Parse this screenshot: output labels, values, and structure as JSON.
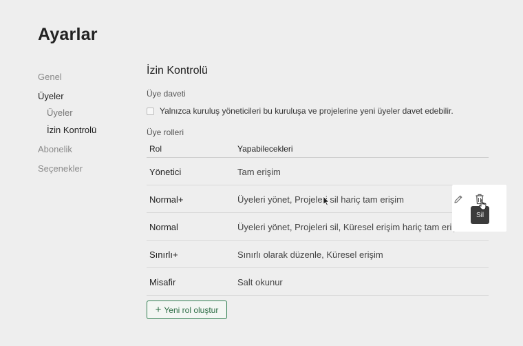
{
  "page": {
    "title": "Ayarlar"
  },
  "sidebar": {
    "items": [
      {
        "label": "Genel"
      },
      {
        "label": "Üyeler"
      },
      {
        "label": "Üyeler"
      },
      {
        "label": "İzin Kontrolü"
      },
      {
        "label": "Abonelik"
      },
      {
        "label": "Seçenekler"
      }
    ]
  },
  "main": {
    "title": "İzin Kontrolü",
    "invite_label": "Üye daveti",
    "invite_checkbox_label": "Yalnızca kuruluş yöneticileri bu kuruluşa ve projelerine yeni üyeler davet edebilir.",
    "invite_checkbox_checked": false,
    "roles_label": "Üye rolleri",
    "table": {
      "headers": [
        "Rol",
        "Yapabilecekleri"
      ],
      "rows": [
        {
          "role": "Yönetici",
          "caps": "Tam erişim"
        },
        {
          "role": "Normal+",
          "caps": "Üyeleri yönet, Projeleri sil hariç tam erişim"
        },
        {
          "role": "Normal",
          "caps": "Üyeleri yönet, Projeleri sil, Küresel erişim hariç tam erişim"
        },
        {
          "role": "Sınırlı+",
          "caps": "Sınırlı olarak düzenle, Küresel erişim"
        },
        {
          "role": "Misafir",
          "caps": "Salt okunur"
        }
      ]
    },
    "new_role_button": "Yeni rol oluştur"
  },
  "row_actions": {
    "edit_icon": "pencil-icon",
    "delete_icon": "trash-icon",
    "tooltip": "Sil"
  },
  "colors": {
    "background": "#eeeeee",
    "accent_green": "#2e7d4f",
    "tooltip_bg": "#3b3b3b"
  }
}
